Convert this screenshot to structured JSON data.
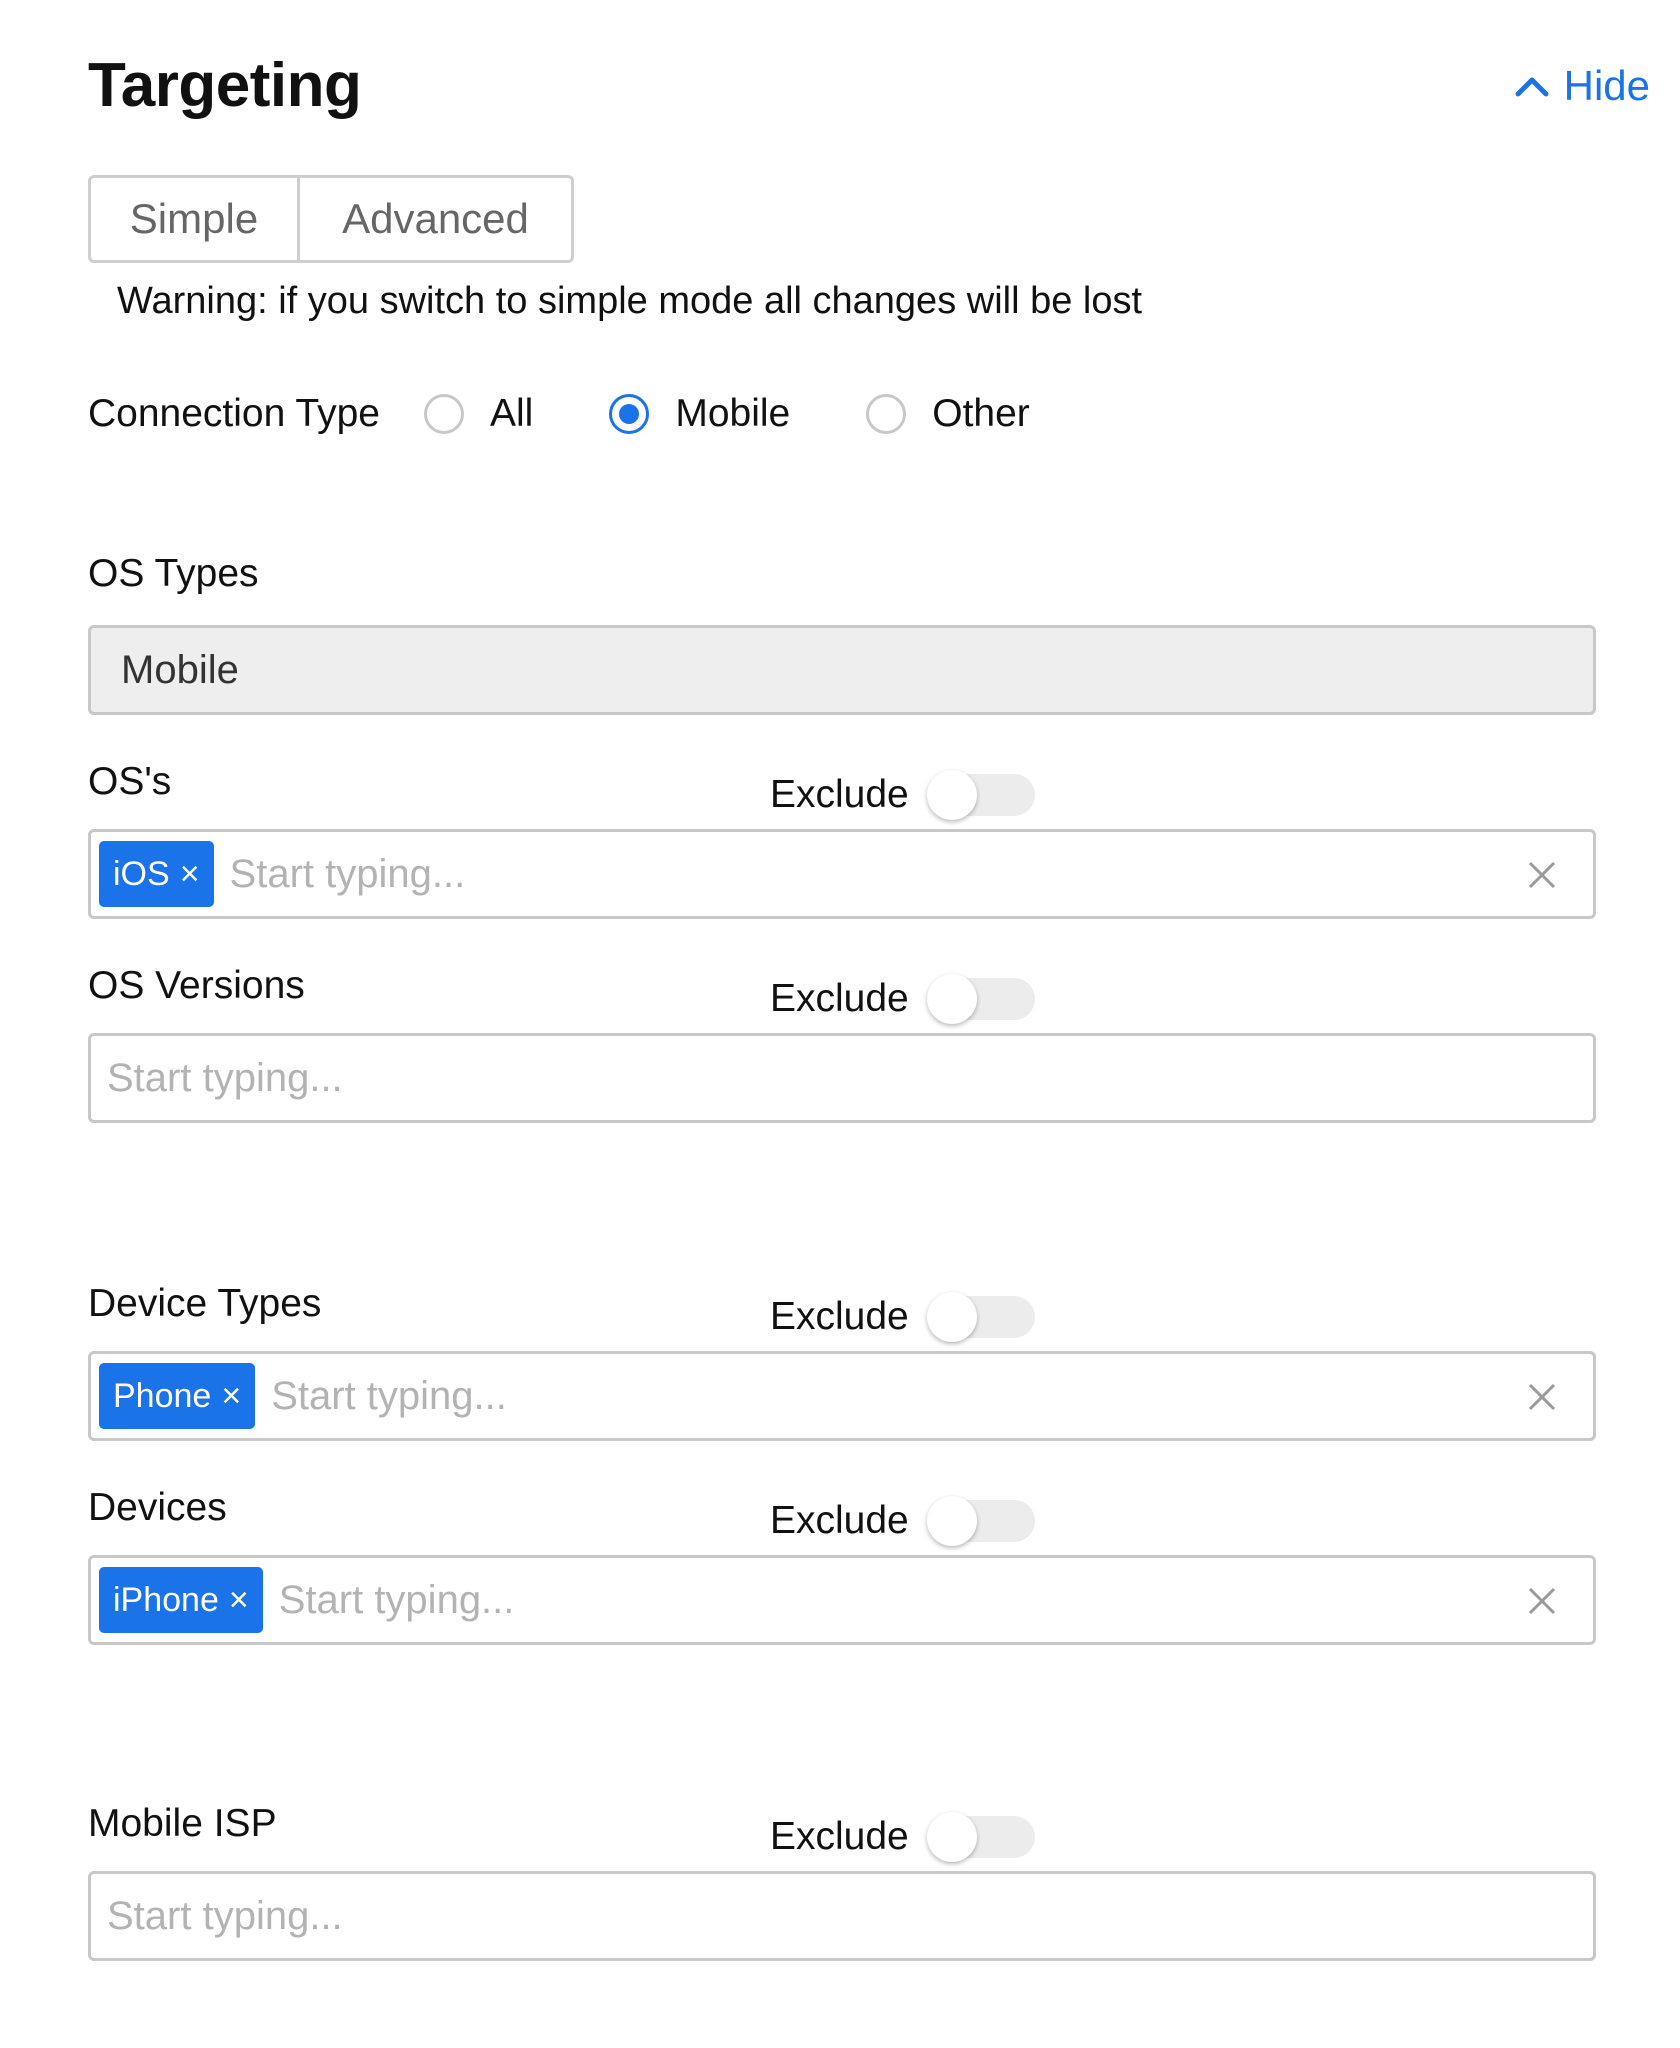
{
  "header": {
    "title": "Targeting",
    "hide_label": "Hide"
  },
  "modes": {
    "simple": "Simple",
    "advanced": "Advanced"
  },
  "warning": "Warning: if you switch to simple mode all changes will be lost",
  "connection_type": {
    "label": "Connection Type",
    "options": [
      "All",
      "Mobile",
      "Other"
    ],
    "selected": "Mobile"
  },
  "os_types": {
    "label": "OS Types",
    "value": "Mobile"
  },
  "exclude_label": "Exclude",
  "placeholder": "Start typing...",
  "oss": {
    "label": "OS's",
    "tags": [
      "iOS"
    ],
    "exclude": false
  },
  "os_versions": {
    "label": "OS Versions",
    "tags": [],
    "exclude": false
  },
  "device_types": {
    "label": "Device Types",
    "tags": [
      "Phone"
    ],
    "exclude": false
  },
  "devices": {
    "label": "Devices",
    "tags": [
      "iPhone"
    ],
    "exclude": false
  },
  "mobile_isp": {
    "label": "Mobile ISP",
    "tags": [],
    "exclude": false
  },
  "icons": {
    "tag_remove": "×",
    "clear": "clear-x-icon",
    "collapse": "chevron-up-icon"
  },
  "colors": {
    "accent": "#1a73e8",
    "border": "#c8c8c8",
    "readonly_bg": "#eeeeee"
  }
}
